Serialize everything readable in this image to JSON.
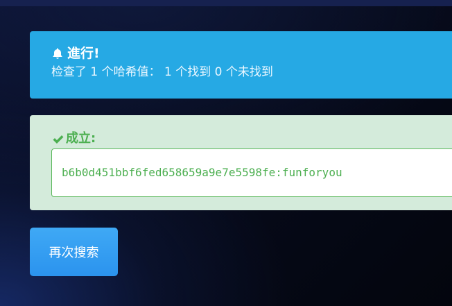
{
  "info_alert": {
    "title": "進行!",
    "message": "检查了 1 个哈希值： 1 个找到 0 个未找到",
    "icon": "bell-icon",
    "color": "#26a9e4"
  },
  "success_alert": {
    "title": "成立:",
    "icon": "check-icon",
    "result": "b6b0d451bbf6fed658659a9e7e5598fe:funforyou",
    "color": "#4caf50",
    "background": "#d4ebdb"
  },
  "actions": {
    "search_again_label": "再次搜索"
  }
}
